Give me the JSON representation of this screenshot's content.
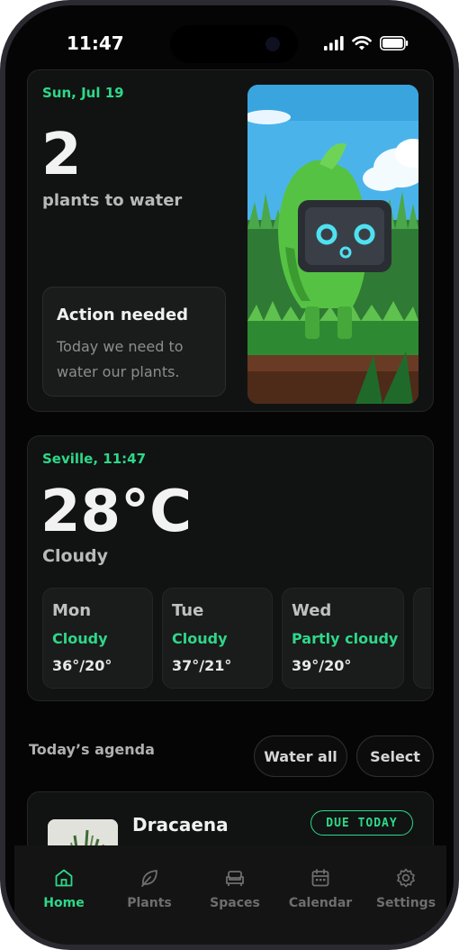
{
  "status": {
    "time": "11:47"
  },
  "summary": {
    "date": "Sun, Jul 19",
    "count": "2",
    "subtitle": "plants to water",
    "action_title": "Action needed",
    "action_text": "Today we need to water our plants."
  },
  "weather": {
    "location_time": "Seville, 11:47",
    "temperature": "28°C",
    "condition": "Cloudy",
    "forecast": [
      {
        "day": "Mon",
        "condition": "Cloudy",
        "range": "36°/20°"
      },
      {
        "day": "Tue",
        "condition": "Cloudy",
        "range": "37°/21°"
      },
      {
        "day": "Wed",
        "condition": "Partly cloudy",
        "range": "39°/20°"
      }
    ]
  },
  "agenda": {
    "title": "Today’s agenda",
    "water_all": "Water all",
    "select": "Select",
    "items": [
      {
        "name": "Dracaena",
        "badge": "DUE TODAY"
      }
    ]
  },
  "tabs": [
    {
      "label": "Home",
      "icon": "home-icon",
      "active": true
    },
    {
      "label": "Plants",
      "icon": "leaf-icon",
      "active": false
    },
    {
      "label": "Spaces",
      "icon": "sofa-icon",
      "active": false
    },
    {
      "label": "Calendar",
      "icon": "calendar-icon",
      "active": false
    },
    {
      "label": "Settings",
      "icon": "gear-icon",
      "active": false
    }
  ],
  "colors": {
    "accent": "#2ed889",
    "background": "#050505",
    "card": "#111312"
  }
}
